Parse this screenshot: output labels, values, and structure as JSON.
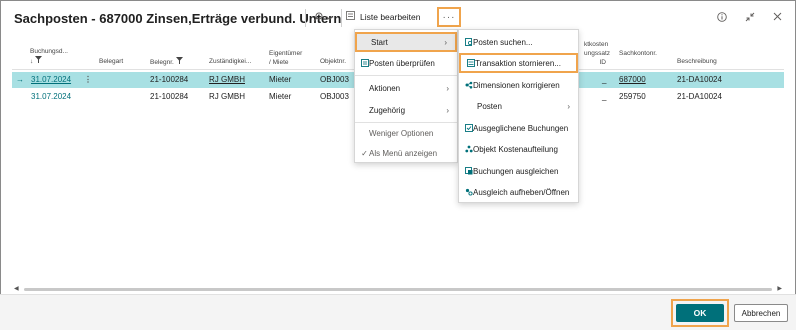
{
  "window": {
    "title": "Sachposten - 687000 Zinsen,Erträge verbund. Untern"
  },
  "toolbar": {
    "edit_list_label": "Liste bearbeiten",
    "more_label": "···"
  },
  "columns": {
    "buchungsdatum": "Buchungsd...",
    "belegart": "Belegart",
    "belegnr": "Belegnr.",
    "zustaendig": "Zuständigkei...",
    "eigentuemer_1": "Eigentümer",
    "eigentuemer_2": "/ Miete",
    "objektnr": "Objektnr.",
    "kostensatz_1": "ktkosten",
    "kostensatz_2": "ungssatz",
    "kostensatz_3": "ID",
    "sachkontonr": "Sachkontonr.",
    "beschreibung": "Beschreibung"
  },
  "rows": [
    {
      "date": "31.07.2024",
      "belegnr": "21-100284",
      "zustaendig": "RJ GMBH",
      "eigentuemer": "Mieter",
      "objektnr": "OBJ003",
      "kostensatz": "_",
      "sachkontonr": "687000",
      "beschreibung": "21-DA10024"
    },
    {
      "date": "31.07.2024",
      "belegnr": "21-100284",
      "zustaendig": "RJ GMBH",
      "eigentuemer": "Mieter",
      "objektnr": "OBJ003",
      "kostensatz": "_",
      "sachkontonr": "259750",
      "beschreibung": "21-DA10024"
    }
  ],
  "menu_main": {
    "items": [
      {
        "label": "Start"
      },
      {
        "label": "Posten überprüfen"
      },
      {
        "label": "Aktionen"
      },
      {
        "label": "Zugehörig"
      },
      {
        "label": "Weniger Optionen"
      },
      {
        "label": "Als Menü anzeigen"
      }
    ]
  },
  "menu_sub": {
    "items": [
      {
        "label": "Posten suchen..."
      },
      {
        "label": "Transaktion stornieren..."
      },
      {
        "label": "Dimensionen korrigieren"
      },
      {
        "label": "Posten"
      },
      {
        "label": "Ausgeglichene Buchungen"
      },
      {
        "label": "Objekt Kostenaufteilung"
      },
      {
        "label": "Buchungen ausgleichen"
      },
      {
        "label": "Ausgleich aufheben/Öffnen"
      }
    ]
  },
  "footer": {
    "ok_label": "OK",
    "cancel_label": "Abbrechen"
  },
  "colors": {
    "accent": "#00707a",
    "highlight": "#f0a44c",
    "selected_row": "#a8e0e3"
  }
}
